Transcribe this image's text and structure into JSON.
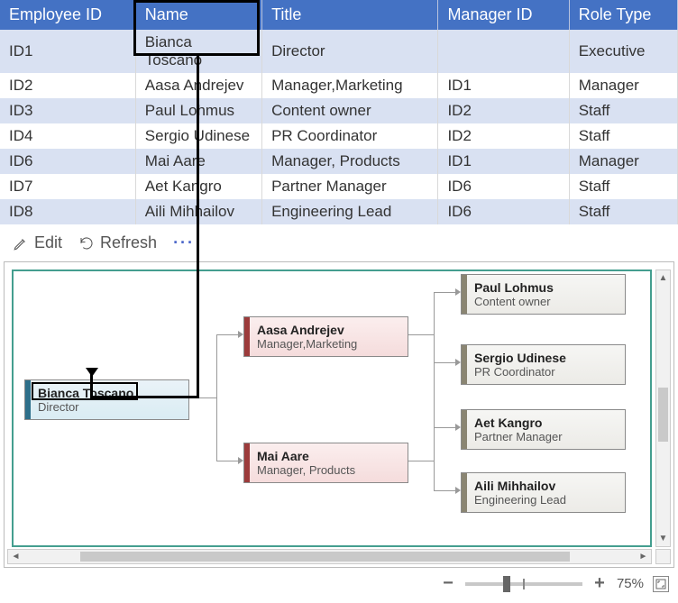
{
  "table": {
    "headers": [
      "Employee ID",
      "Name",
      "Title",
      "Manager ID",
      "Role Type"
    ],
    "rows": [
      {
        "id": "ID1",
        "name": "Bianca Toscano",
        "title": "Director",
        "mgr": "",
        "role": "Executive"
      },
      {
        "id": "ID2",
        "name": "Aasa Andrejev",
        "title": "Manager,Marketing",
        "mgr": "ID1",
        "role": "Manager"
      },
      {
        "id": "ID3",
        "name": "Paul Lohmus",
        "title": "Content owner",
        "mgr": "ID2",
        "role": "Staff"
      },
      {
        "id": "ID4",
        "name": "Sergio Udinese",
        "title": "PR Coordinator",
        "mgr": "ID2",
        "role": "Staff"
      },
      {
        "id": "ID6",
        "name": "Mai Aare",
        "title": "Manager, Products",
        "mgr": "ID1",
        "role": "Manager"
      },
      {
        "id": "ID7",
        "name": "Aet Kangro",
        "title": "Partner Manager",
        "mgr": "ID6",
        "role": "Staff"
      },
      {
        "id": "ID8",
        "name": "Aili Mihhailov",
        "title": "Engineering Lead",
        "mgr": "ID6",
        "role": "Staff"
      }
    ]
  },
  "toolbar": {
    "edit": "Edit",
    "refresh": "Refresh"
  },
  "org": {
    "root": {
      "name": "Bianca Toscano",
      "title": "Director"
    },
    "mgr1": {
      "name": "Aasa Andrejev",
      "title": "Manager,Marketing"
    },
    "mgr2": {
      "name": "Mai Aare",
      "title": "Manager, Products"
    },
    "staff1": {
      "name": "Paul Lohmus",
      "title": "Content owner"
    },
    "staff2": {
      "name": "Sergio Udinese",
      "title": "PR Coordinator"
    },
    "staff3": {
      "name": "Aet Kangro",
      "title": "Partner Manager"
    },
    "staff4": {
      "name": "Aili Mihhailov",
      "title": "Engineering Lead"
    }
  },
  "zoom": {
    "value": "75%"
  }
}
